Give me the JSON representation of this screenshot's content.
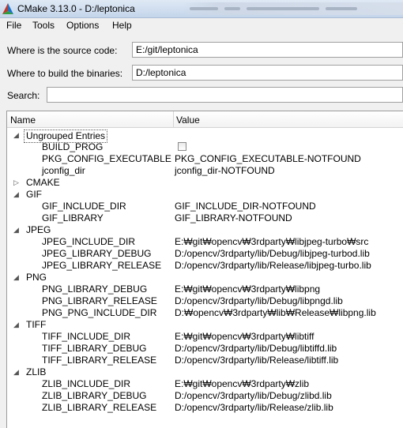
{
  "window": {
    "title": "CMake 3.13.0 - D:/leptonica"
  },
  "menu": [
    "File",
    "Tools",
    "Options",
    "Help"
  ],
  "source": {
    "label": "Where is the source code:",
    "value": "E:/git/leptonica"
  },
  "build": {
    "label": "Where to build the binaries:",
    "value": "D:/leptonica"
  },
  "search": {
    "label": "Search:",
    "value": ""
  },
  "tree": {
    "headers": {
      "name": "Name",
      "value": "Value"
    },
    "groups": [
      {
        "name": "Ungrouped Entries",
        "expanded": true,
        "entries": [
          {
            "name": "BUILD_PROG",
            "type": "checkbox",
            "checked": false,
            "value": ""
          },
          {
            "name": "PKG_CONFIG_EXECUTABLE",
            "value": "PKG_CONFIG_EXECUTABLE-NOTFOUND"
          },
          {
            "name": "jconfig_dir",
            "value": "jconfig_dir-NOTFOUND"
          }
        ]
      },
      {
        "name": "CMAKE",
        "expanded": false,
        "entries": []
      },
      {
        "name": "GIF",
        "expanded": true,
        "entries": [
          {
            "name": "GIF_INCLUDE_DIR",
            "value": "GIF_INCLUDE_DIR-NOTFOUND"
          },
          {
            "name": "GIF_LIBRARY",
            "value": "GIF_LIBRARY-NOTFOUND"
          }
        ]
      },
      {
        "name": "JPEG",
        "expanded": true,
        "entries": [
          {
            "name": "JPEG_INCLUDE_DIR",
            "value": "E:₩git₩opencv₩3rdparty₩libjpeg-turbo₩src"
          },
          {
            "name": "JPEG_LIBRARY_DEBUG",
            "value": "D:/opencv/3rdparty/lib/Debug/libjpeg-turbod.lib"
          },
          {
            "name": "JPEG_LIBRARY_RELEASE",
            "value": "D:/opencv/3rdparty/lib/Release/libjpeg-turbo.lib"
          }
        ]
      },
      {
        "name": "PNG",
        "expanded": true,
        "entries": [
          {
            "name": "PNG_LIBRARY_DEBUG",
            "value": "E:₩git₩opencv₩3rdparty₩libpng"
          },
          {
            "name": "PNG_LIBRARY_RELEASE",
            "value": "D:/opencv/3rdparty/lib/Debug/libpngd.lib"
          },
          {
            "name": "PNG_PNG_INCLUDE_DIR",
            "value": "D:₩opencv₩3rdparty₩lib₩Release₩libpng.lib"
          }
        ]
      },
      {
        "name": "TIFF",
        "expanded": true,
        "entries": [
          {
            "name": "TIFF_INCLUDE_DIR",
            "value": "E:₩git₩opencv₩3rdparty₩libtiff"
          },
          {
            "name": "TIFF_LIBRARY_DEBUG",
            "value": "D:/opencv/3rdparty/lib/Debug/libtiffd.lib"
          },
          {
            "name": "TIFF_LIBRARY_RELEASE",
            "value": "D:/opencv/3rdparty/lib/Release/libtiff.lib"
          }
        ]
      },
      {
        "name": "ZLIB",
        "expanded": true,
        "entries": [
          {
            "name": "ZLIB_INCLUDE_DIR",
            "value": "E:₩git₩opencv₩3rdparty₩zlib"
          },
          {
            "name": "ZLIB_LIBRARY_DEBUG",
            "value": "D:/opencv/3rdparty/lib/Debug/zlibd.lib"
          },
          {
            "name": "ZLIB_LIBRARY_RELEASE",
            "value": "D:/opencv/3rdparty/lib/Release/zlib.lib"
          }
        ]
      }
    ]
  }
}
